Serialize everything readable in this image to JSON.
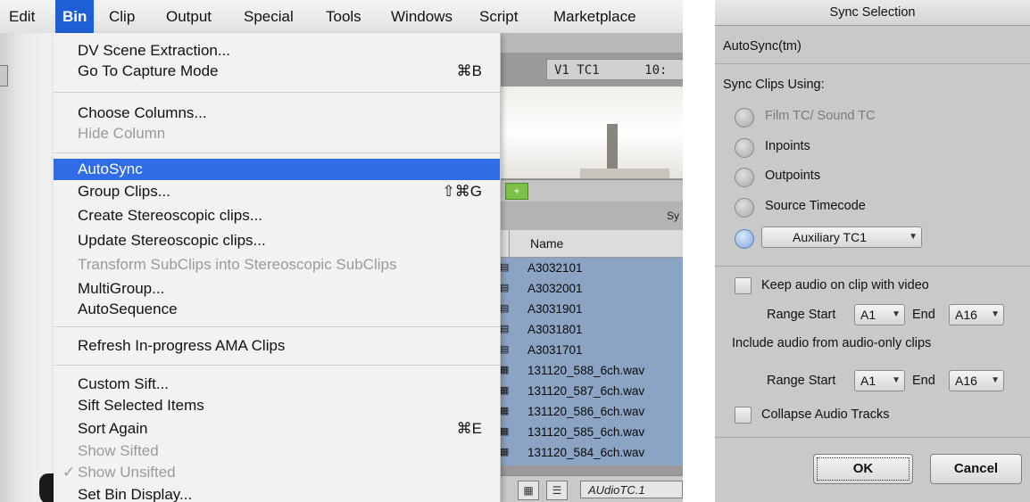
{
  "menubar": {
    "items": [
      "Edit",
      "Bin",
      "Clip",
      "Output",
      "Special",
      "Tools",
      "Windows",
      "Script",
      "Marketplace"
    ],
    "active": "Bin"
  },
  "bin_menu": {
    "items": [
      {
        "label": "DV Scene Extraction...",
        "shortcut": "",
        "state": "enabled"
      },
      {
        "label": "Go To Capture Mode",
        "shortcut": "⌘B",
        "state": "enabled"
      },
      {
        "label": "Choose Columns...",
        "shortcut": "",
        "state": "enabled"
      },
      {
        "label": "Hide Column",
        "shortcut": "",
        "state": "disabled"
      },
      {
        "label": "AutoSync",
        "shortcut": "",
        "state": "highlighted"
      },
      {
        "label": "Group Clips...",
        "shortcut": "⇧⌘G",
        "state": "enabled"
      },
      {
        "label": "Create Stereoscopic clips...",
        "shortcut": "",
        "state": "enabled"
      },
      {
        "label": "Update Stereoscopic clips...",
        "shortcut": "",
        "state": "enabled"
      },
      {
        "label": "Transform SubClips into Stereoscopic SubClips",
        "shortcut": "",
        "state": "disabled"
      },
      {
        "label": "MultiGroup...",
        "shortcut": "",
        "state": "enabled"
      },
      {
        "label": "AutoSequence",
        "shortcut": "",
        "state": "enabled"
      },
      {
        "label": "Refresh In-progress AMA Clips",
        "shortcut": "",
        "state": "enabled"
      },
      {
        "label": "Custom Sift...",
        "shortcut": "",
        "state": "enabled"
      },
      {
        "label": "Sift Selected Items",
        "shortcut": "",
        "state": "enabled"
      },
      {
        "label": "Sort Again",
        "shortcut": "⌘E",
        "state": "enabled"
      },
      {
        "label": "Show Sifted",
        "shortcut": "",
        "state": "disabled"
      },
      {
        "label": "Show Unsifted",
        "shortcut": "",
        "state": "disabled",
        "check": "✓"
      },
      {
        "label": "Set Bin Display...",
        "shortcut": "",
        "state": "enabled"
      }
    ]
  },
  "bin_window": {
    "timecode_label": "V1 TC1      10:",
    "tab_label": "Sy",
    "plus_label": "+",
    "column_header": "Name",
    "rows": [
      {
        "name": "A3032101",
        "type": "video"
      },
      {
        "name": "A3032001",
        "type": "video"
      },
      {
        "name": "A3031901",
        "type": "video"
      },
      {
        "name": "A3031801",
        "type": "video"
      },
      {
        "name": "A3031701",
        "type": "video"
      },
      {
        "name": "131120_588_6ch.wav",
        "type": "audio"
      },
      {
        "name": "131120_587_6ch.wav",
        "type": "audio"
      },
      {
        "name": "131120_586_6ch.wav",
        "type": "audio"
      },
      {
        "name": "131120_585_6ch.wav",
        "type": "audio"
      },
      {
        "name": "131120_584_6ch.wav",
        "type": "audio"
      }
    ],
    "bin_view_dropdown": "AUdioTC.1"
  },
  "sync_dialog": {
    "title": "Sync Selection",
    "method": "AutoSync(tm)",
    "sync_clips_using_label": "Sync Clips Using:",
    "options": [
      {
        "label": "Film TC/ Sound TC",
        "enabled": false,
        "selected": false
      },
      {
        "label": "Inpoints",
        "enabled": true,
        "selected": false
      },
      {
        "label": "Outpoints",
        "enabled": true,
        "selected": false
      },
      {
        "label": "Source Timecode",
        "enabled": true,
        "selected": false
      }
    ],
    "aux_option": {
      "value": "Auxiliary TC1",
      "selected": true
    },
    "keep_audio_label": "Keep audio on clip with video",
    "keep_audio_checked": false,
    "range1": {
      "start_label": "Range Start",
      "start": "A1",
      "end_label": "End",
      "end": "A16"
    },
    "include_audio_label": "Include audio from audio-only clips",
    "range2": {
      "start_label": "Range Start",
      "start": "A1",
      "end_label": "End",
      "end": "A16"
    },
    "collapse_label": "Collapse Audio Tracks",
    "collapse_checked": false,
    "ok_label": "OK",
    "cancel_label": "Cancel"
  },
  "colors": {
    "menu_highlight": "#2f6ce5",
    "menubar_active": "#1f5fd6",
    "bin_selection": "#8ca4c4",
    "dialog_bg": "#c9c9c9"
  }
}
